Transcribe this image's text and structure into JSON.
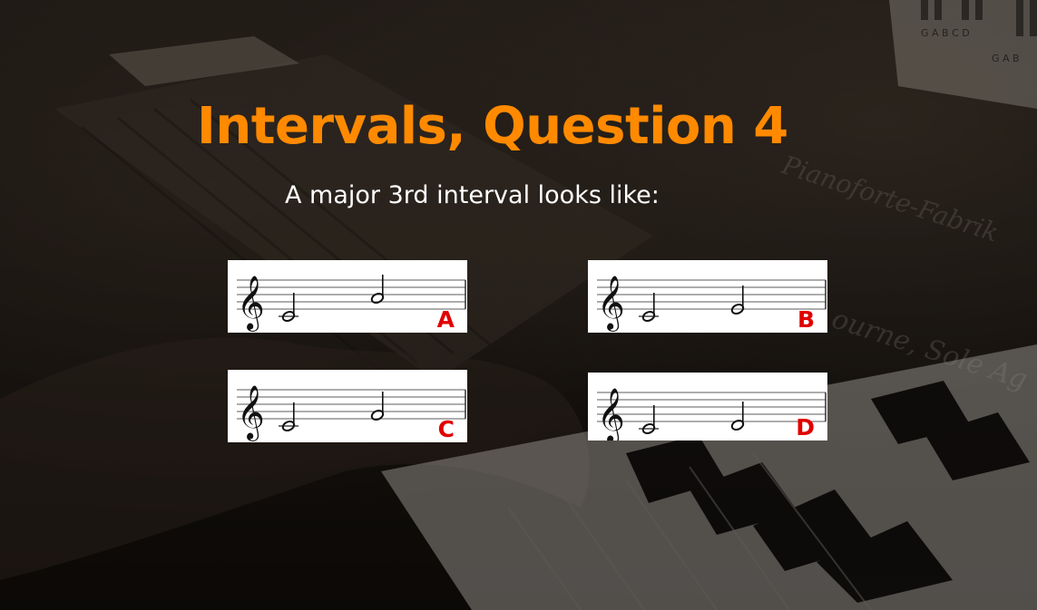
{
  "question": {
    "title": "Intervals, Question 4",
    "prompt": "A major 3rd interval looks like:"
  },
  "options": [
    {
      "letter": "A",
      "notes": [
        "C4",
        "A4"
      ]
    },
    {
      "letter": "B",
      "notes": [
        "C4",
        "E4"
      ]
    },
    {
      "letter": "C",
      "notes": [
        "C4",
        "F4"
      ]
    },
    {
      "letter": "D",
      "notes": [
        "C4",
        "D4"
      ]
    }
  ],
  "background": {
    "keyboard_labels": [
      "G A B C D",
      "G A B"
    ],
    "brand_text": "Pianoforte-Fabrik",
    "brand_text_2": "ourne, Sole Ag"
  },
  "colors": {
    "title": "#ff8a00",
    "prompt": "#ffffff",
    "option_letter": "#e10000",
    "option_bg": "#ffffff"
  }
}
